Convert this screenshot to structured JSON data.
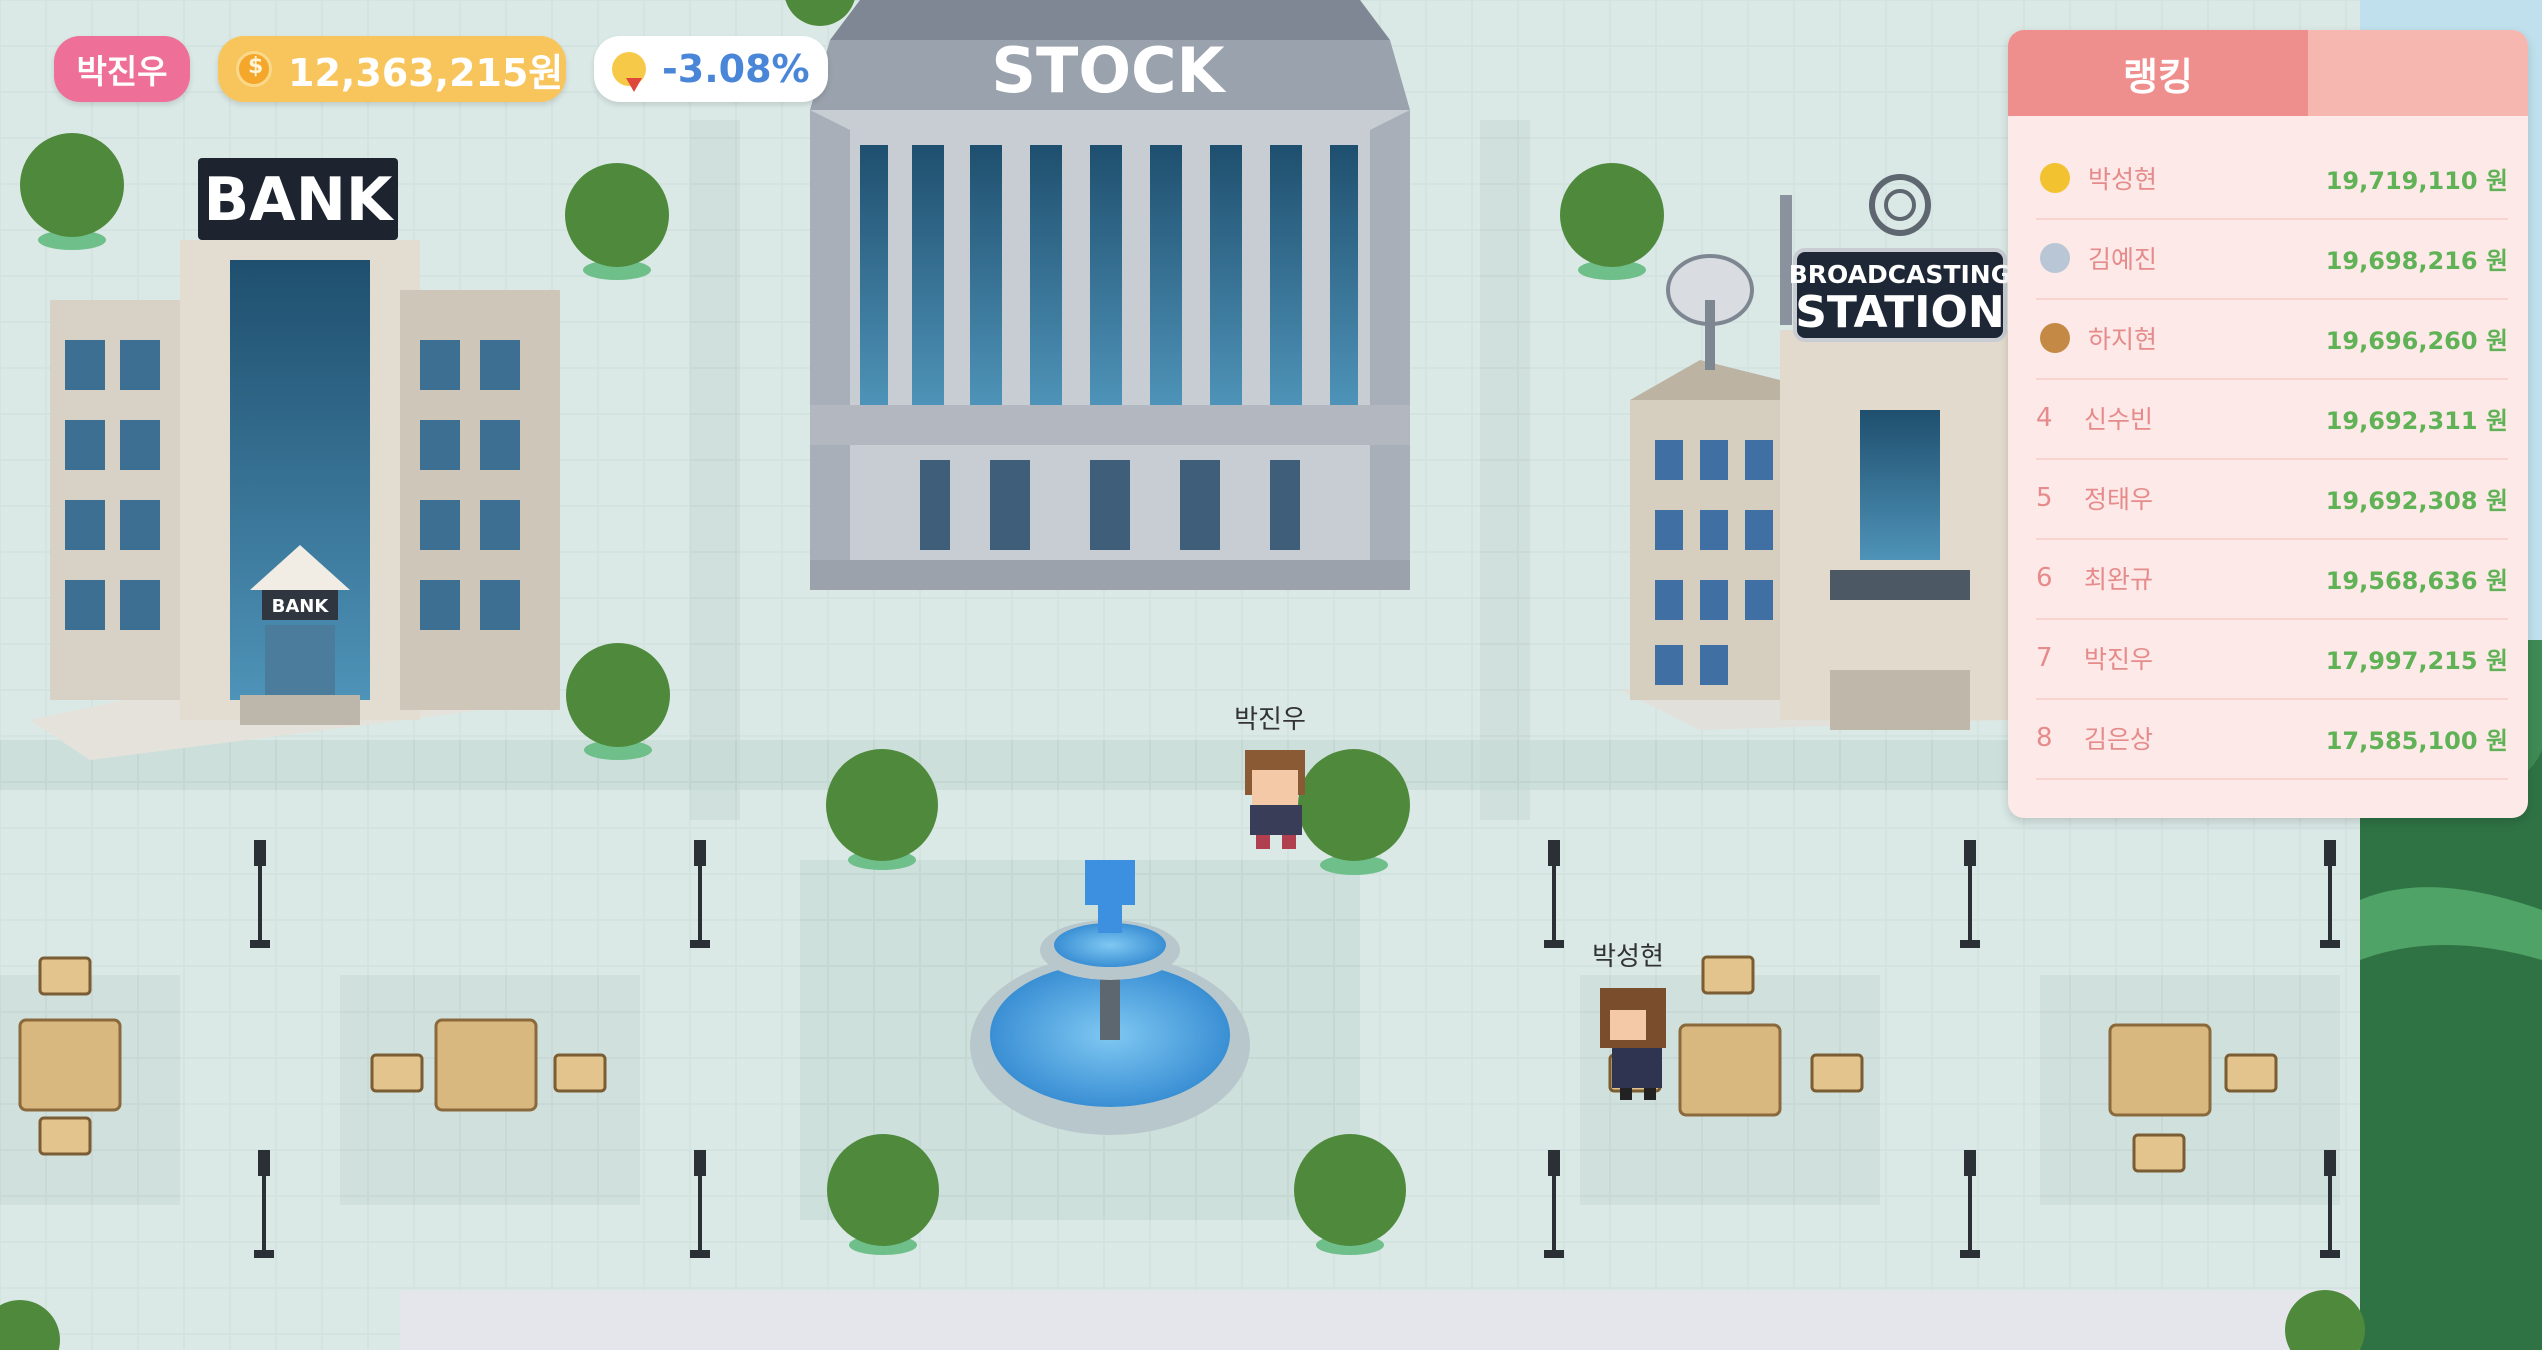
{
  "hud": {
    "player_name": "박진우",
    "money": "12,363,215원",
    "rate": "-3.08%",
    "coin_icon": "coin-icon",
    "rate_icon": "bulb-down-icon"
  },
  "buildings": {
    "bank_sign": "BANK",
    "bank_door_sign": "BANK",
    "stock_sign": "STOCK",
    "broadcast_sign_top": "BROADCASTING",
    "broadcast_sign_bottom": "STATION"
  },
  "characters": {
    "player_label": "박진우",
    "npc_label": "박성현"
  },
  "ranking": {
    "title": "랭킹",
    "rows": [
      {
        "rank": "",
        "medal": "gold",
        "name": "박성현",
        "value": "19,719,110 원"
      },
      {
        "rank": "",
        "medal": "silver",
        "name": "김예진",
        "value": "19,698,216 원"
      },
      {
        "rank": "",
        "medal": "bronze",
        "name": "하지현",
        "value": "19,696,260 원"
      },
      {
        "rank": "4",
        "medal": "",
        "name": "신수빈",
        "value": "19,692,311 원"
      },
      {
        "rank": "5",
        "medal": "",
        "name": "정태우",
        "value": "19,692,308 원"
      },
      {
        "rank": "6",
        "medal": "",
        "name": "최완규",
        "value": "19,568,636 원"
      },
      {
        "rank": "7",
        "medal": "",
        "name": "박진우",
        "value": "17,997,215 원"
      },
      {
        "rank": "8",
        "medal": "",
        "name": "김은상",
        "value": "17,585,100 원"
      }
    ]
  },
  "colors": {
    "name_pill": "#ee6f97",
    "money_pill": "#f8c55d",
    "rate_text": "#4a86d8",
    "ranking_header": "#ef8f8d",
    "ranking_value": "#5fb255"
  }
}
